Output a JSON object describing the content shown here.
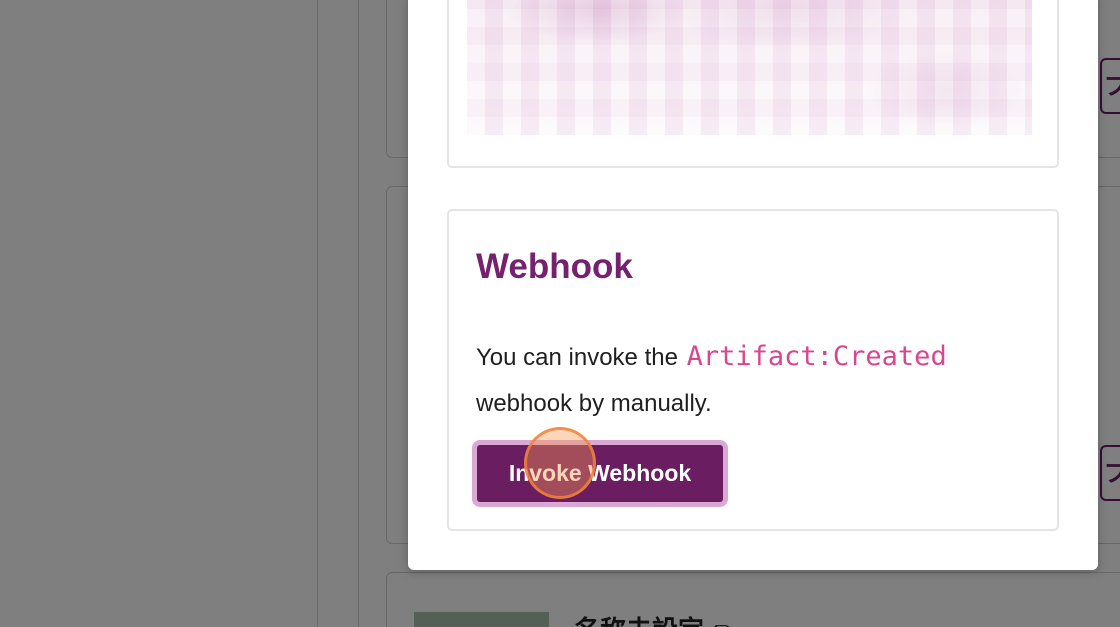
{
  "background": {
    "side_button_label": "プ",
    "card_title": "名称未設定 ✏"
  },
  "modal": {
    "webhook_section": {
      "title": "Webhook",
      "description_before": "You can invoke the",
      "event_name": "Artifact:Created",
      "description_after": "webhook by manually.",
      "button_label": "Invoke Webhook"
    }
  },
  "colors": {
    "accent": "#76216f",
    "button_bg": "#6b1d62",
    "button_ring": "#d9a9d3",
    "code": "#d9468f",
    "click_indicator": "#f0823c"
  }
}
